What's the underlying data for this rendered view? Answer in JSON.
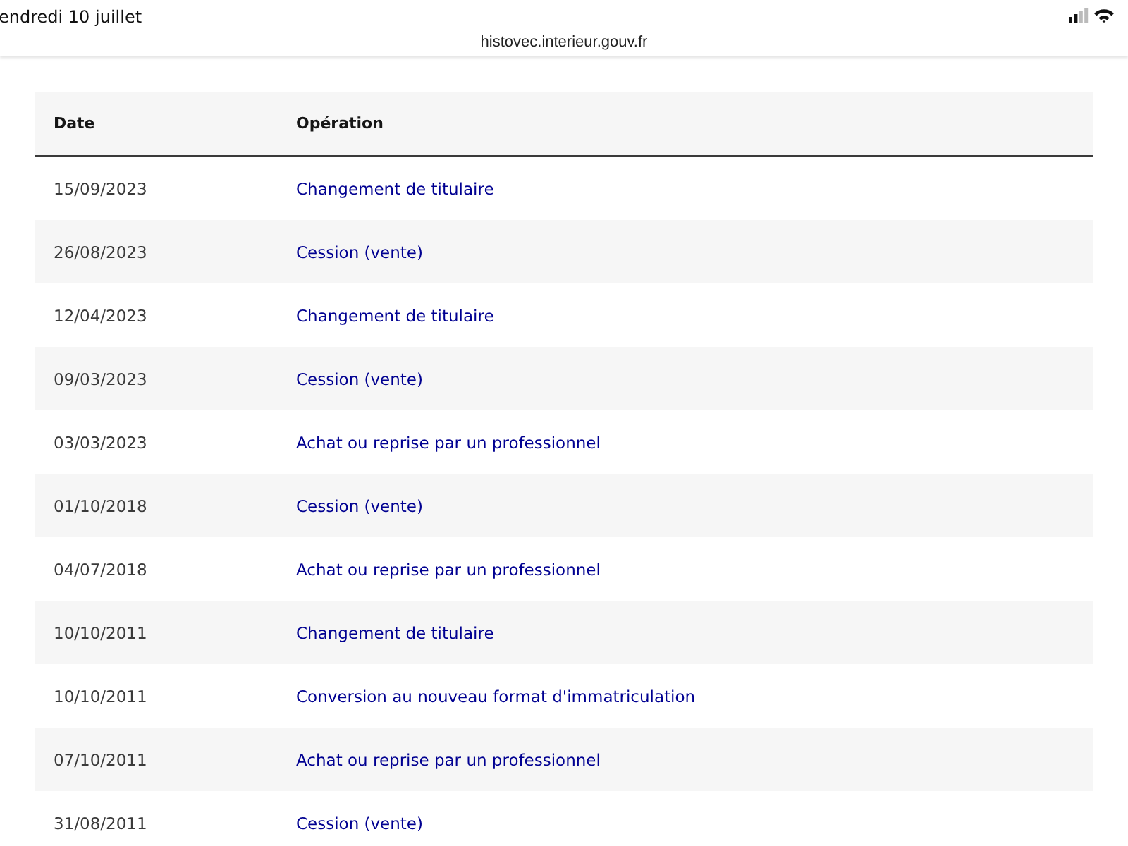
{
  "status_bar": {
    "date": "endredi 10 juillet"
  },
  "address_bar": {
    "url": "histovec.interieur.gouv.fr"
  },
  "table": {
    "columns": [
      "Date",
      "Opération"
    ],
    "rows": [
      {
        "date": "15/09/2023",
        "operation": "Changement de titulaire"
      },
      {
        "date": "26/08/2023",
        "operation": "Cession (vente)"
      },
      {
        "date": "12/04/2023",
        "operation": "Changement de titulaire"
      },
      {
        "date": "09/03/2023",
        "operation": "Cession (vente)"
      },
      {
        "date": "03/03/2023",
        "operation": "Achat ou reprise par un professionnel"
      },
      {
        "date": "01/10/2018",
        "operation": "Cession (vente)"
      },
      {
        "date": "04/07/2018",
        "operation": "Achat ou reprise par un professionnel"
      },
      {
        "date": "10/10/2011",
        "operation": "Changement de titulaire"
      },
      {
        "date": "10/10/2011",
        "operation": "Conversion au nouveau format d'immatriculation"
      },
      {
        "date": "07/10/2011",
        "operation": "Achat ou reprise par un professionnel"
      },
      {
        "date": "31/08/2011",
        "operation": "Cession (vente)"
      }
    ]
  }
}
